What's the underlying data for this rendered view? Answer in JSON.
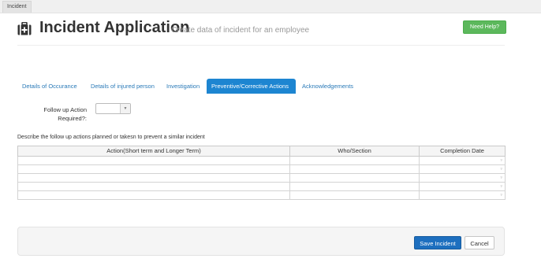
{
  "breadcrumb": {
    "label": "Incident"
  },
  "header": {
    "title": "Incident Application",
    "subtitle": "Create data of incident for an employee",
    "help_label": "Need Help?",
    "icon": "first-aid-kit-icon"
  },
  "tabs": [
    {
      "label": "Details of Occurance",
      "active": false
    },
    {
      "label": "Details of injured person",
      "active": false
    },
    {
      "label": "Investigation",
      "active": false
    },
    {
      "label": "Preventive/Corrective Actions",
      "active": true
    },
    {
      "label": "Acknowledgements",
      "active": false
    }
  ],
  "form": {
    "followup_label": "Follow up Action Required?:",
    "followup_value": "",
    "describe_text": "Describe the follow up actions planned or takesn to prevent a similar incident"
  },
  "table": {
    "columns": [
      "Action(Short term and Longer Term)",
      "Who/Section",
      "Completion Date"
    ],
    "rows": [
      [
        "",
        "",
        ""
      ],
      [
        "",
        "",
        ""
      ],
      [
        "",
        "",
        ""
      ],
      [
        "",
        "",
        ""
      ],
      [
        "",
        "",
        ""
      ]
    ]
  },
  "actions": {
    "save_label": "Save Incident",
    "cancel_label": "Cancel"
  },
  "colors": {
    "active_tab": "#1d85d1",
    "tab_link": "#2a7ab8",
    "help_button": "#5cb85c",
    "save_button": "#1d6fbf"
  }
}
